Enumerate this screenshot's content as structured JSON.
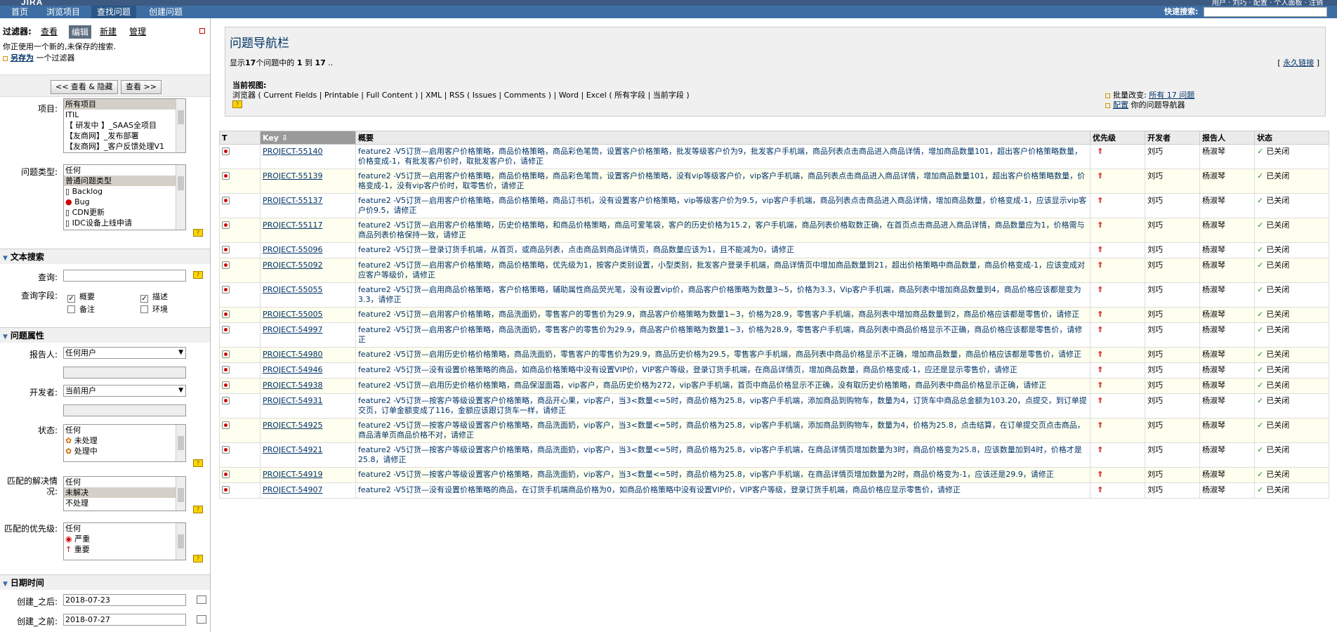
{
  "app": {
    "logo": "JIRA",
    "top_right": "用户 · 刘巧 · 配置 · 个人面板 · 注销"
  },
  "nav": {
    "items": [
      "首页",
      "浏览项目",
      "查找问题",
      "创建问题"
    ],
    "active_index": 2,
    "quick_search_label": "快速搜索:"
  },
  "sidebar": {
    "filter_label": "过滤器:",
    "filter_tabs": [
      "查看",
      "编辑",
      "新建",
      "管理"
    ],
    "unsaved_msg": "你正使用一个新的,未保存的搜索.",
    "save_as_link": "另存为",
    "save_as_tail": "一个过滤器",
    "btn_view_hide": "<< 查看 & 隐藏",
    "btn_view": "查看 >>",
    "project_label": "项目:",
    "projects": [
      "所有项目",
      "ITIL",
      "【 研发中 】_SAAS全项目",
      "【友商网】_发布部署",
      "【友商网】_客户反馈处理V1"
    ],
    "issue_type_label": "问题类型:",
    "issue_types": [
      "任何",
      "普通问题类型",
      "Backlog",
      "Bug",
      "CDN更新",
      "IDC设备上线申请"
    ],
    "text_search_header": "文本搜索",
    "query_label": "查询:",
    "query_fields_label": "查询字段:",
    "fields": {
      "summary": "概要",
      "description": "描述",
      "comments": "备注",
      "environment": "环境"
    },
    "issue_attr_header": "问题属性",
    "reporter_label": "报告人:",
    "reporter_value": "任何用户",
    "assignee_label": "开发者:",
    "assignee_value": "当前用户",
    "status_label": "状态:",
    "statuses": [
      "任何",
      "未处理",
      "处理中"
    ],
    "resolution_label": "匹配的解决情况:",
    "resolutions": [
      "任何",
      "未解决",
      "不处理"
    ],
    "priority_label": "匹配的优先级:",
    "priorities": [
      "任何",
      "严重",
      "重要"
    ],
    "date_header": "日期时间",
    "created_after_label": "创建_之后:",
    "created_after": "2018-07-23",
    "created_before_label": "创建_之前:",
    "created_before": "2018-07-27"
  },
  "navigator": {
    "title": "问题导航栏",
    "count_prefix": "显示",
    "count_total": "17",
    "count_mid": "个问题中的",
    "count_from": "1",
    "count_to_word": "到",
    "count_to": "17",
    "permalink": "永久链接",
    "current_view_label": "当前视图:",
    "views_text": "浏览器 ( Current Fields | Printable | Full Content ) | XML | RSS ( Issues | Comments ) | Word | Excel ( 所有字段 | 当前字段 )",
    "bulk_change": "批量改变:",
    "bulk_all": "所有 17 问题",
    "config_link": "配置",
    "config_tail": "你的问题导航器"
  },
  "table": {
    "headers": [
      "T",
      "Key",
      "概要",
      "优先级",
      "开发者",
      "报告人",
      "状态"
    ],
    "rows": [
      {
        "key": "PROJECT-55140",
        "summary": "feature2 -V5订货—启用客户价格策略，商品价格策略，商品彩色笔筒，设置客户价格策略，批发等级客户价为9，批发客户手机端，商品列表点击商品进入商品详情，增加商品数量101，超出客户价格策略数量，价格变成-1，有批发客户价时，取批发客户价，请修正",
        "assignee": "刘巧",
        "reporter": "杨淑琴",
        "status": "已关闭"
      },
      {
        "key": "PROJECT-55139",
        "summary": "feature2 -V5订货—启用客户价格策略，商品价格策略，商品彩色笔筒，设置客户价格策略，没有vip等级客户价，vip客户手机端，商品列表点击商品进入商品详情，增加商品数量101，超出客户价格策略数量，价格变成-1，没有vip客户价时，取零售价，请修正",
        "assignee": "刘巧",
        "reporter": "杨淑琴",
        "status": "已关闭"
      },
      {
        "key": "PROJECT-55137",
        "summary": "feature2 -V5订货—启用客户价格策略，商品价格策略，商品订书机，没有设置客户价格策略，vip等级客户价为9.5，vip客户手机端，商品列表点击商品进入商品详情，增加商品数量，价格变成-1，应该显示vip客户价9.5，请修正",
        "assignee": "刘巧",
        "reporter": "杨淑琴",
        "status": "已关闭"
      },
      {
        "key": "PROJECT-55117",
        "summary": "feature2 -V5订货—启用客户价格策略，历史价格策略，和商品价格策略，商品可爱笔袋，客户的历史价格为15.2，客户手机端，商品列表价格取数正确，在首页点击商品进入商品详情，商品数量应为1，价格需与商品列表价格保持一致，请修正",
        "assignee": "刘巧",
        "reporter": "杨淑琴",
        "status": "已关闭"
      },
      {
        "key": "PROJECT-55096",
        "summary": "feature2 -V5订货—登录订货手机端，从首页，或商品列表，点击商品到商品详情页，商品数量应该为1，且不能减为0，请修正",
        "assignee": "刘巧",
        "reporter": "杨淑琴",
        "status": "已关闭"
      },
      {
        "key": "PROJECT-55092",
        "summary": "feature2 -V5订货—启用客户价格策略，商品价格策略，优先级为1，按客户类别设置，小型类别，批发客户登录手机端，商品详情页中增加商品数量到21，超出价格策略中商品数量，商品价格变成-1，应该变成对应客户等级价，请修正",
        "assignee": "刘巧",
        "reporter": "杨淑琴",
        "status": "已关闭"
      },
      {
        "key": "PROJECT-55055",
        "summary": "feature2 -V5订货—启用商品价格策略，客户价格策略，辅助属性商品荧光笔，没有设置vip价，商品客户价格策略为数量3~5，价格为3.3，Vip客户手机端，商品列表中增加商品数量到4，商品价格应该都是变为3.3，请修正",
        "assignee": "刘巧",
        "reporter": "杨淑琴",
        "status": "已关闭"
      },
      {
        "key": "PROJECT-55005",
        "summary": "feature2 -V5订货—启用客户价格策略，商品洗面奶，零售客户的零售价为29.9，商品客户价格策略为数量1~3，价格为28.9，零售客户手机端，商品列表中增加商品数量到2，商品价格应该都是零售价，请修正",
        "assignee": "刘巧",
        "reporter": "杨淑琴",
        "status": "已关闭"
      },
      {
        "key": "PROJECT-54997",
        "summary": "feature2 -V5订货—启用客户价格策略，商品洗面奶，零售客户的零售价为29.9，商品客户价格策略为数量1~3，价格为28.9，零售客户手机端，商品列表中商品价格显示不正确，商品价格应该都是零售价，请修正",
        "assignee": "刘巧",
        "reporter": "杨淑琴",
        "status": "已关闭"
      },
      {
        "key": "PROJECT-54980",
        "summary": "feature2 -V5订货—启用历史价格价格策略，商品洗面奶，零售客户的零售价为29.9，商品历史价格为29.5，零售客户手机端，商品列表中商品价格显示不正确，增加商品数量，商品价格应该都是零售价，请修正",
        "assignee": "刘巧",
        "reporter": "杨淑琴",
        "status": "已关闭"
      },
      {
        "key": "PROJECT-54946",
        "summary": "feature2 -V5订货—没有设置价格策略的商品，如商品价格策略中没有设置VIP价，VIP客户等级，登录订货手机端，在商品详情页，增加商品数量，商品价格变成-1，应还是显示零售价，请修正",
        "assignee": "刘巧",
        "reporter": "杨淑琴",
        "status": "已关闭"
      },
      {
        "key": "PROJECT-54938",
        "summary": "feature2 -V5订货—启用历史价格价格策略，商品保湿面霜，vip客户，商品历史价格为272，vip客户手机端，首页中商品价格显示不正确，没有取历史价格策略，商品列表中商品价格显示正确，请修正",
        "assignee": "刘巧",
        "reporter": "杨淑琴",
        "status": "已关闭"
      },
      {
        "key": "PROJECT-54931",
        "summary": "feature2 -V5订货—按客户等级设置客户价格策略，商品开心果，vip客户，当3<数量<=5时，商品价格为25.8，vip客户手机端，添加商品到购物车，数量为4，订货车中商品总金额为103.20，点提交，到订单提交页，订单金额变成了116，金额应该跟订货车一样，请修正",
        "assignee": "刘巧",
        "reporter": "杨淑琴",
        "status": "已关闭"
      },
      {
        "key": "PROJECT-54925",
        "summary": "feature2 -V5订货—按客户等级设置客户价格策略，商品洗面奶，vip客户，当3<数量<=5时，商品价格为25.8，vip客户手机端，添加商品到购物车，数量为4，价格为25.8，点击结算，在订单提交页点击商品，商品清单页商品价格不对，请修正",
        "assignee": "刘巧",
        "reporter": "杨淑琴",
        "status": "已关闭"
      },
      {
        "key": "PROJECT-54921",
        "summary": "feature2 -V5订货—按客户等级设置客户价格策略，商品洗面奶，vip客户，当3<数量<=5时，商品价格为25.8，vip客户手机端，在商品详情页增加数量为3时，商品价格变为25.8，应该数量加到4时，价格才是25.8，请修正",
        "assignee": "刘巧",
        "reporter": "杨淑琴",
        "status": "已关闭"
      },
      {
        "key": "PROJECT-54919",
        "summary": "feature2 -V5订货—按客户等级设置客户价格策略，商品洗面奶，vip客户，当3<数量<=5时，商品价格为25.8，vip客户手机端，在商品详情页增加数量为2时，商品价格变为-1，应该还是29.9，请修正",
        "assignee": "刘巧",
        "reporter": "杨淑琴",
        "status": "已关闭"
      },
      {
        "key": "PROJECT-54907",
        "summary": "feature2 -V5订货—没有设置价格策略的商品，在订货手机端商品价格为0，如商品价格策略中没有设置VIP价，VIP客户等级，登录订货手机端，商品价格应显示零售价，请修正",
        "assignee": "刘巧",
        "reporter": "杨淑琴",
        "status": "已关闭"
      }
    ]
  },
  "colors": {
    "nav_bg": "#3c6ea4",
    "link": "#003366",
    "alt_row": "#ffffef",
    "priority_red": "#cc0000",
    "status_green": "#2c8a2c"
  },
  "icons": {
    "issue_type": "bug-icon",
    "priority": "priority-arrow-icon",
    "status": "closed-check-icon",
    "help": "help-icon",
    "calendar": "calendar-icon"
  }
}
